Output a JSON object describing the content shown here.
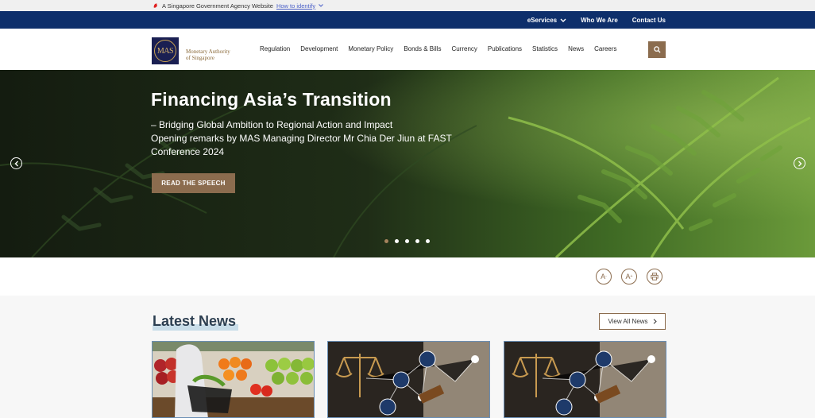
{
  "gov_banner": {
    "text": "A Singapore Government Agency Website",
    "link": "How to identify"
  },
  "utility_nav": {
    "eservices": "eServices",
    "who_we_are": "Who We Are",
    "contact_us": "Contact Us"
  },
  "logo": {
    "mark": "MAS",
    "line1": "Monetary Authority",
    "line2": "of Singapore"
  },
  "main_nav": {
    "items": [
      "Regulation",
      "Development",
      "Monetary Policy",
      "Bonds & Bills",
      "Currency",
      "Publications",
      "Statistics",
      "News",
      "Careers"
    ]
  },
  "hero": {
    "title": "Financing Asia’s Transition",
    "subtitle_line1": "– Bridging Global Ambition to Regional Action and Impact",
    "subtitle_line2": "Opening remarks by MAS Managing Director Mr Chia Der Jiun at FAST Conference 2024",
    "cta": "READ THE SPEECH",
    "slide_count": 5,
    "active_slide": 1
  },
  "tools": {
    "decrease_font": "A",
    "increase_font": "A",
    "print_icon": "print-icon"
  },
  "news": {
    "title": "Latest News",
    "view_all": "View All News"
  },
  "colors": {
    "navy": "#0e2f6b",
    "gold_brown": "#8b6c4e",
    "logo_bg": "#1a1f52"
  }
}
